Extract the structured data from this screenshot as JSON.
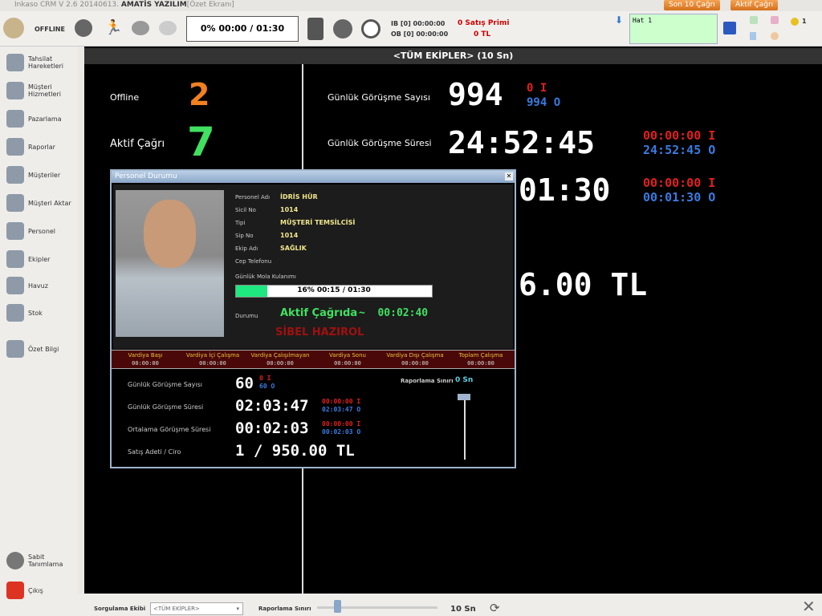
{
  "window": {
    "title_prefix": "Inkaso CRM V 2.6 20140613.",
    "title_company": "AMATİS YAZILIM",
    "title_suffix": "[Özet Ekranı]",
    "btn_last10": "Son 10 Çağrı",
    "btn_active": "Aktif Çağrı"
  },
  "toolbar": {
    "status": "OFFLINE",
    "break_usage": "0% 00:00 / 01:30",
    "ib": "IB [0] 00:00:00",
    "ob": "OB [0] 00:00:00",
    "bonus_title": "0 Satış Primi",
    "bonus_value": "0 TL",
    "line": "Hat 1",
    "count": "1"
  },
  "sidebar": [
    "Tahsilat Hareketleri",
    "Müşteri Hizmetleri",
    "Pazarlama",
    "Raporlar",
    "Müşteriler",
    "Müşteri Aktar",
    "Personel",
    "Ekipler",
    "Havuz",
    "Stok",
    "Özet Bilgi",
    "Sabit Tanımlama",
    "Çıkış"
  ],
  "main": {
    "header": "<TÜM EKİPLER> (10 Sn)",
    "offline_label": "Offline",
    "offline_value": "2",
    "active_label": "Aktif Çağrı",
    "active_value": "7",
    "call_count_label": "Günlük Görüşme Sayısı",
    "call_count": "994",
    "call_count_in": "0 I",
    "call_count_out": "994 O",
    "call_time_label": "Günlük Görüşme Süresi",
    "call_time": "24:52:45",
    "call_time_in": "00:00:00 I",
    "call_time_out": "24:52:45 O",
    "avg_time": "01:30",
    "avg_in": "00:00:00 I",
    "avg_out": "00:01:30 O",
    "revenue": "6.00 TL"
  },
  "dialog": {
    "title": "Personel Durumu",
    "fields": [
      {
        "label": "Personel Adı",
        "value": "İDRİS HÜR"
      },
      {
        "label": "Sicil No",
        "value": "1014"
      },
      {
        "label": "Tipi",
        "value": "MÜŞTERİ TEMSİLCİSİ"
      },
      {
        "label": "Sip No",
        "value": "1014"
      },
      {
        "label": "Ekip Adı",
        "value": "SAĞLIK"
      },
      {
        "label": "Cep Telefonu",
        "value": ""
      }
    ],
    "break_label": "Günlük Mola Kulanımı",
    "break_text": "16% 00:15 / 01:30",
    "break_percent": 16,
    "status_label": "Durumu",
    "status": "Aktif Çağrıda",
    "status_time": "~  00:02:40",
    "message": "SİBEL HAZIROL",
    "shifts": [
      {
        "label": "Vardiya Başı",
        "value": "00:00:00"
      },
      {
        "label": "Vardiya İçi Çalışma",
        "value": "00:00:00"
      },
      {
        "label": "Vardiya Çalışılmayan",
        "value": "00:00:00"
      },
      {
        "label": "Vardiya Sonu",
        "value": "00:00:00"
      },
      {
        "label": "Vardiya Dışı Çalışma",
        "value": "00:00:00"
      },
      {
        "label": "Toplam Çalışma",
        "value": "00:00:00"
      }
    ],
    "stats": [
      {
        "label": "Günlük Görüşme  Sayısı",
        "value": "60",
        "in": "0 I",
        "out": "60 O"
      },
      {
        "label": "Günlük Görüşme Süresi",
        "value": "02:03:47",
        "in": "00:00:00 I",
        "out": "02:03:47 O"
      },
      {
        "label": "Ortalama Görüşme Süresi",
        "value": "00:02:03",
        "in": "00:00:00 I",
        "out": "00:02:03 O"
      },
      {
        "label": "Satış Adeti / Ciro",
        "value": "1 / 950.00 TL",
        "in": "",
        "out": ""
      }
    ],
    "report_limit_label": "Raporlama Sınırı",
    "report_limit": "0 Sn"
  },
  "bottom": {
    "team_label": "Sorgulama Ekibi",
    "team_value": "<TÜM EKİPLER>",
    "limit_label": "Raporlama Sınırı",
    "limit_value": "10 Sn"
  }
}
